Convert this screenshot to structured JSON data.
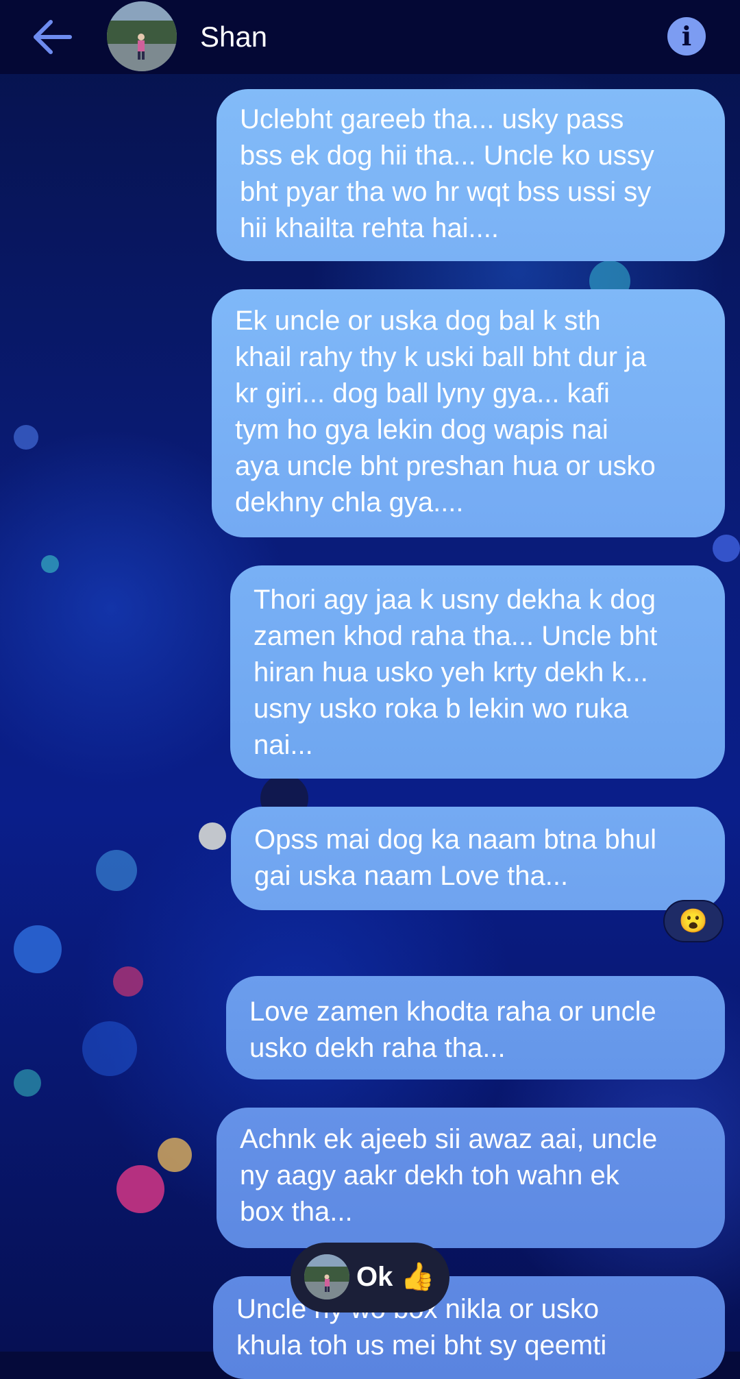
{
  "header": {
    "contact_name": "Shan",
    "back_icon": "arrow-left-icon",
    "info_icon": "info-icon",
    "info_glyph": "i"
  },
  "messages": [
    {
      "text": "Uclebht gareeb tha... usky pass\nbss ek dog hii tha... Uncle ko ussy\nbht pyar tha wo hr wqt bss ussi sy\nhii khailta rehta hai...."
    },
    {
      "text": "Ek uncle or uska dog bal k sth\nkhail rahy thy k uski ball bht dur ja\nkr giri... dog ball lyny gya... kafi\ntym ho gya lekin dog wapis nai\naya uncle bht preshan hua or usko\ndekhny chla gya...."
    },
    {
      "text": "Thori agy jaa k usny dekha k dog\nzamen khod raha tha... Uncle bht\nhiran hua usko yeh krty dekh k...\nusny usko roka b lekin wo ruka\nnai..."
    },
    {
      "text": "Opss mai dog ka naam btna bhul\ngai uska naam Love tha...",
      "reaction": "😮"
    },
    {
      "text": "Love zamen khodta raha or uncle\nusko dekh raha tha..."
    },
    {
      "text": "Achnk ek ajeeb sii awaz aai, uncle\nny aagy aakr dekh toh wahn ek\nbox tha..."
    },
    {
      "text": "Uncle ny wo box nikla or usko\nkhula toh us mei bht sy qeemti"
    }
  ],
  "reply_preview": {
    "text": "Ok 👍"
  },
  "colors": {
    "header_bg": "#040835",
    "bubble_light": "#7fb6f7",
    "bubble_mid": "#6f9de9",
    "bubble_dark": "#5f88e0",
    "accent": "#7c9cf2"
  }
}
